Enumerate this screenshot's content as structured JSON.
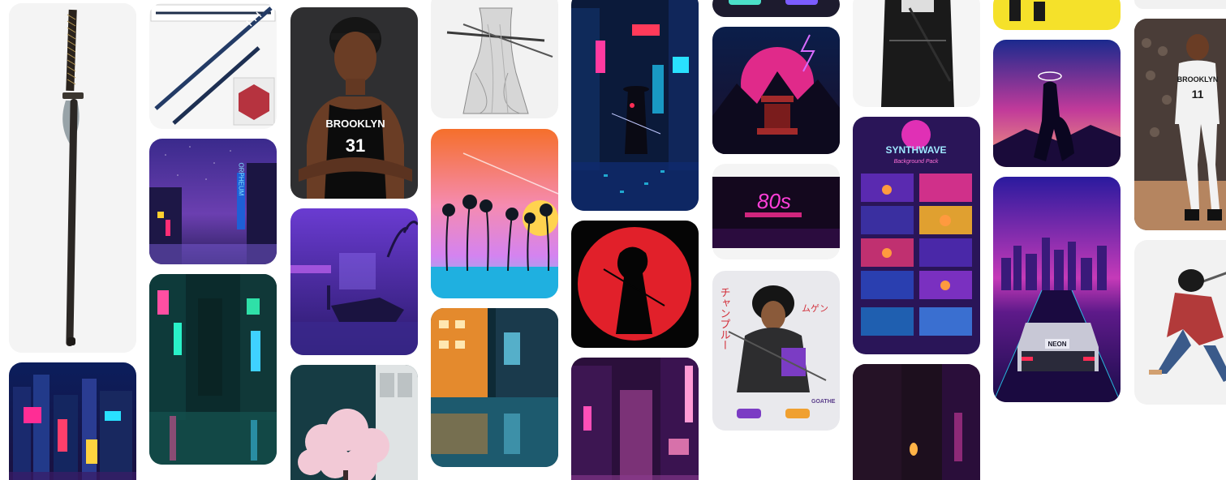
{
  "board": {
    "pins": [
      {
        "id": "katana-sheathed",
        "title": "Katana with dark scabbard"
      },
      {
        "id": "tokyo-neon-street",
        "title": "Tokyo neon street at night"
      },
      {
        "id": "katana-blue-pair",
        "title": "Blue katana with sheath"
      },
      {
        "id": "orpheum-street",
        "title": "Neon street with Orpheum sign",
        "sign": "ORPHEUM"
      },
      {
        "id": "rainy-alley",
        "title": "Rainy neon alley"
      },
      {
        "id": "basketball-player",
        "title": "Basketball player portrait",
        "jersey_team": "BROOKLYN",
        "jersey_number": "31"
      },
      {
        "id": "purple-neon-car",
        "title": "Purple neon night with car"
      },
      {
        "id": "cherry-blossom",
        "title": "Cherry blossom at night"
      },
      {
        "id": "samurai-sketch",
        "title": "Samurai pencil sketch"
      },
      {
        "id": "palm-sunset",
        "title": "Synthwave palm sunset"
      },
      {
        "id": "reflection-street",
        "title": "Neon reflections street"
      },
      {
        "id": "cyber-samurai-city",
        "title": "Cyber samurai in neon city"
      },
      {
        "id": "red-sun-samurai",
        "title": "Samurai silhouette in red sun"
      },
      {
        "id": "pink-alley",
        "title": "Pink neon alley"
      },
      {
        "id": "top-cropped-pin",
        "title": "Cropped pin"
      },
      {
        "id": "temple-lightning",
        "title": "Temple under neon lightning"
      },
      {
        "id": "neon-80s-sign",
        "title": "Neon 80s sign",
        "sign_text": "80s"
      },
      {
        "id": "mugen-anime",
        "title": "Anime samurai in hoodie",
        "jp_vertical": "チャンプルー",
        "jp_name": "ムゲン",
        "signature": "GOATHE"
      },
      {
        "id": "samurai-bw",
        "title": "Black and white samurai"
      },
      {
        "id": "synthwave-pack",
        "title": "Synthwave background pack",
        "heading": "SYNTHWAVE",
        "subheading": "Background Pack"
      },
      {
        "id": "dark-alley-lantern",
        "title": "Dark alley with lantern"
      },
      {
        "id": "yellow-crop",
        "title": "Cropped yellow pin"
      },
      {
        "id": "halo-figure",
        "title": "Figure with halo at synthwave dusk"
      },
      {
        "id": "neon-car-city",
        "title": "Neon car in synthwave city",
        "plate": "NEON"
      },
      {
        "id": "player-dribble",
        "title": "Basketball player dribbling",
        "jersey_team": "BROOKLYN",
        "jersey_number": "11"
      },
      {
        "id": "samurai-action",
        "title": "Anime samurai in action"
      },
      {
        "id": "top-right-crop",
        "title": "Cropped pin top right"
      }
    ]
  },
  "colors": {
    "neon_pink": "#ff2d95",
    "neon_cyan": "#29e1ff",
    "synth_purple": "#6a2cff",
    "sun_red": "#e1202a",
    "placeholder": "#f1f1f1"
  }
}
